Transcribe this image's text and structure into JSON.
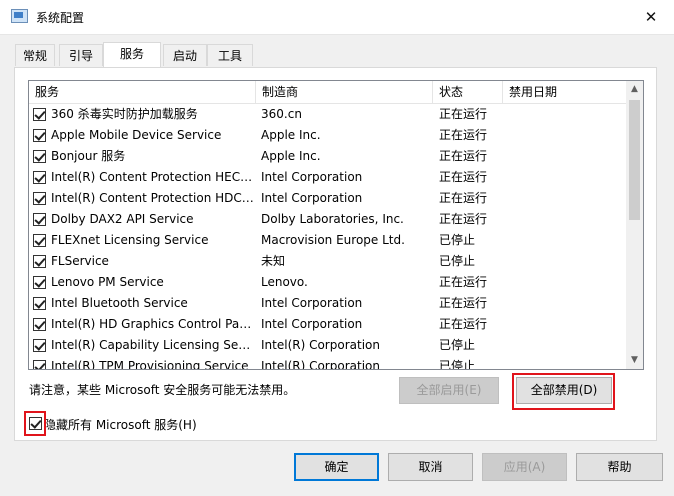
{
  "window": {
    "title": "系统配置",
    "close_glyph": "✕"
  },
  "tabs": [
    {
      "label": "常规",
      "active": false
    },
    {
      "label": "引导",
      "active": false
    },
    {
      "label": "服务",
      "active": true
    },
    {
      "label": "启动",
      "active": false
    },
    {
      "label": "工具",
      "active": false
    }
  ],
  "services_list": {
    "headers": {
      "service": "服务",
      "manufacturer": "制造商",
      "status": "状态",
      "disabled_date": "禁用日期"
    },
    "rows": [
      {
        "checked": true,
        "service": "360 杀毒实时防护加载服务",
        "manufacturer": "360.cn",
        "status": "正在运行",
        "disabled_date": ""
      },
      {
        "checked": true,
        "service": "Apple Mobile Device Service",
        "manufacturer": "Apple Inc.",
        "status": "正在运行",
        "disabled_date": ""
      },
      {
        "checked": true,
        "service": "Bonjour 服务",
        "manufacturer": "Apple Inc.",
        "status": "正在运行",
        "disabled_date": ""
      },
      {
        "checked": true,
        "service": "Intel(R) Content Protection HECI ...",
        "manufacturer": "Intel Corporation",
        "status": "正在运行",
        "disabled_date": ""
      },
      {
        "checked": true,
        "service": "Intel(R) Content Protection HDCP...",
        "manufacturer": "Intel Corporation",
        "status": "正在运行",
        "disabled_date": ""
      },
      {
        "checked": true,
        "service": "Dolby DAX2 API Service",
        "manufacturer": "Dolby Laboratories, Inc.",
        "status": "正在运行",
        "disabled_date": ""
      },
      {
        "checked": true,
        "service": "FLEXnet Licensing Service",
        "manufacturer": "Macrovision Europe Ltd.",
        "status": "已停止",
        "disabled_date": ""
      },
      {
        "checked": true,
        "service": "FLService",
        "manufacturer": "未知",
        "status": "已停止",
        "disabled_date": ""
      },
      {
        "checked": true,
        "service": "Lenovo PM Service",
        "manufacturer": "Lenovo.",
        "status": "正在运行",
        "disabled_date": ""
      },
      {
        "checked": true,
        "service": "Intel Bluetooth Service",
        "manufacturer": "Intel Corporation",
        "status": "正在运行",
        "disabled_date": ""
      },
      {
        "checked": true,
        "service": "Intel(R) HD Graphics Control Pan...",
        "manufacturer": "Intel Corporation",
        "status": "正在运行",
        "disabled_date": ""
      },
      {
        "checked": true,
        "service": "Intel(R) Capability Licensing Servi...",
        "manufacturer": "Intel(R) Corporation",
        "status": "已停止",
        "disabled_date": ""
      },
      {
        "checked": true,
        "service": "Intel(R) TPM Provisioning Service",
        "manufacturer": "Intel(R) Corporation",
        "status": "已停止",
        "disabled_date": ""
      }
    ],
    "scroll_up_glyph": "▲",
    "scroll_down_glyph": "▼"
  },
  "notice": "请注意，某些 Microsoft 安全服务可能无法禁用。",
  "enable_all_label": "全部启用(E)",
  "disable_all_label": "全部禁用(D)",
  "hide_ms": {
    "label": "隐藏所有 Microsoft 服务(H)",
    "checked": true
  },
  "footer": {
    "ok": "确定",
    "cancel": "取消",
    "apply": "应用(A)",
    "help": "帮助"
  },
  "colors": {
    "highlight": "#e0141b",
    "default_button_border": "#0078d7"
  }
}
